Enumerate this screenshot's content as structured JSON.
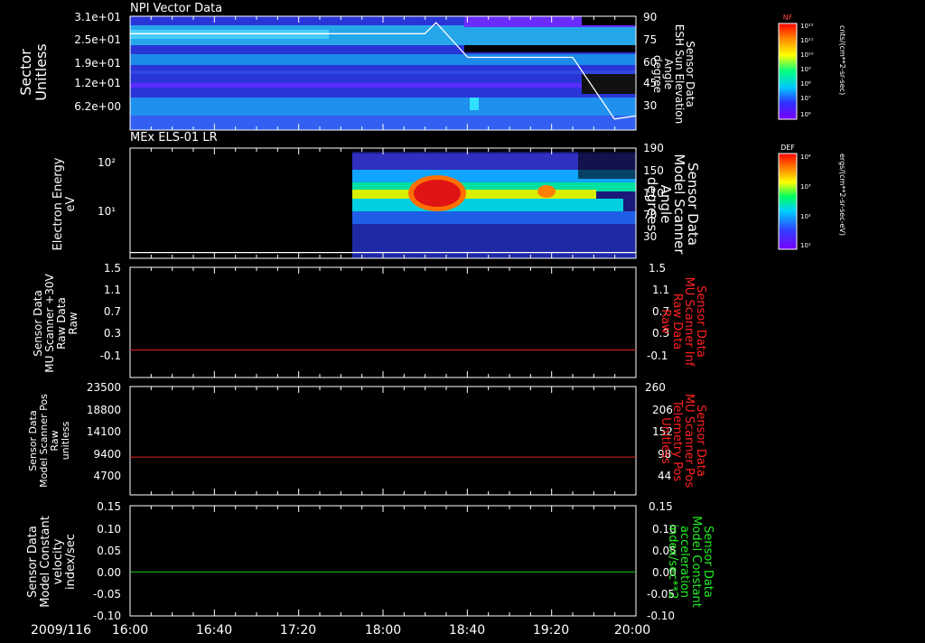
{
  "date_label": "2009/116",
  "time_ticks": [
    "16:00",
    "16:40",
    "17:20",
    "18:00",
    "18:40",
    "19:20",
    "20:00"
  ],
  "colors": {
    "background": "#000000",
    "axis": "#ffffff",
    "right_red": "#ff2020",
    "right_green": "#22ee22",
    "trace_red": "#e02020",
    "trace_green": "#22cc22",
    "trace_white": "#ffffff"
  },
  "colorbars": [
    {
      "title": "NF",
      "ticks": [
        "10¹²",
        "10¹¹",
        "10¹⁰",
        "10⁹",
        "10⁸",
        "10⁷",
        "10⁶"
      ],
      "unit": "cnts/(cm**2-sr-sec)"
    },
    {
      "title": "DEF",
      "ticks": [
        "10⁴",
        "10³",
        "10²",
        "10¹"
      ],
      "unit": "ergs/(cm**2-sr-sec-eV)"
    }
  ],
  "chart_data": [
    {
      "type": "heatmap",
      "title": "NPI Vector Data",
      "ylabel": [
        "Sector",
        "Unitless"
      ],
      "yticks": [
        "3.1e+01",
        "2.5e+01",
        "1.9e+01",
        "1.2e+01",
        "6.2e+00"
      ],
      "right_label": [
        "Sensor Data",
        "ESH Sun Elevation",
        "Angle",
        "degree"
      ],
      "right_ticks": [
        "90",
        "75",
        "60",
        "45",
        "30"
      ],
      "right_ylim": [
        18,
        90
      ],
      "overlay_series": {
        "name": "ESH Sun Elevation Angle",
        "x_hours": [
          16.0,
          18.33,
          18.42,
          18.5,
          18.67,
          19.5,
          19.83,
          20.0
        ],
        "y": [
          79,
          79,
          86,
          79,
          64,
          64,
          25,
          27
        ]
      }
    },
    {
      "type": "heatmap",
      "title": "MEx ELS-01 LR",
      "ylabel": [
        "Electron Energy",
        "eV"
      ],
      "yticks": [
        "10²",
        "10¹"
      ],
      "y_scale": "log",
      "data_start": "17:33",
      "right_label": [
        "Sensor Data",
        "Model Scanner",
        "Angle",
        "degrees"
      ],
      "right_ticks": [
        "190",
        "150",
        "110",
        "70",
        "30"
      ],
      "right_ylim": [
        0,
        190
      ],
      "overlay_series": {
        "name": "Model Scanner Angle",
        "x_hours": [
          16.0,
          20.0
        ],
        "y": [
          10,
          10
        ]
      }
    },
    {
      "type": "line",
      "ylabel": [
        "Sensor Data",
        "MU Scanner +30V",
        "Raw Data",
        "Raw"
      ],
      "yticks": [
        "1.5",
        "1.1",
        "0.7",
        "0.3",
        "-0.1"
      ],
      "ylim": [
        -0.5,
        1.5
      ],
      "right_label": [
        "Sensor Data",
        "MU Scanner Inf",
        "Raw Data",
        "Raw"
      ],
      "right_ticks": [
        "1.5",
        "1.1",
        "0.7",
        "0.3",
        "-0.1"
      ],
      "series": [
        {
          "color": "#e02020",
          "values": [
            0.0,
            0.0
          ]
        }
      ],
      "x_hours": [
        16.0,
        20.0
      ]
    },
    {
      "type": "line",
      "ylabel": [
        "Sensor Data",
        "Model Scanner Pos",
        "Raw",
        "unitless"
      ],
      "yticks": [
        "23500",
        "18800",
        "14100",
        "9400",
        "4700"
      ],
      "ylim": [
        0,
        23500
      ],
      "right_label": [
        "Sensor Data",
        "MU Scanner Pos",
        "Telemetry Pos",
        "Unitless"
      ],
      "right_ticks": [
        "260",
        "206",
        "152",
        "98",
        "44"
      ],
      "series": [
        {
          "color": "#e02020",
          "values": [
            8200,
            8200
          ]
        }
      ],
      "x_hours": [
        16.0,
        20.0
      ]
    },
    {
      "type": "line",
      "ylabel": [
        "Sensor Data",
        "Model Constant",
        "velocity",
        "index/sec"
      ],
      "yticks": [
        "0.15",
        "0.10",
        "0.05",
        "0.00",
        "-0.05",
        "-0.10"
      ],
      "ylim": [
        -0.1,
        0.15
      ],
      "right_label": [
        "Sensor Data",
        "Model Constant",
        "acceleration",
        "index/sec**2"
      ],
      "right_ticks": [
        "0.15",
        "0.10",
        "0.05",
        "0.00",
        "-0.05",
        "-0.10"
      ],
      "series": [
        {
          "color": "#22cc22",
          "values": [
            0.0,
            0.0
          ]
        }
      ],
      "x_hours": [
        16.0,
        20.0
      ]
    }
  ]
}
